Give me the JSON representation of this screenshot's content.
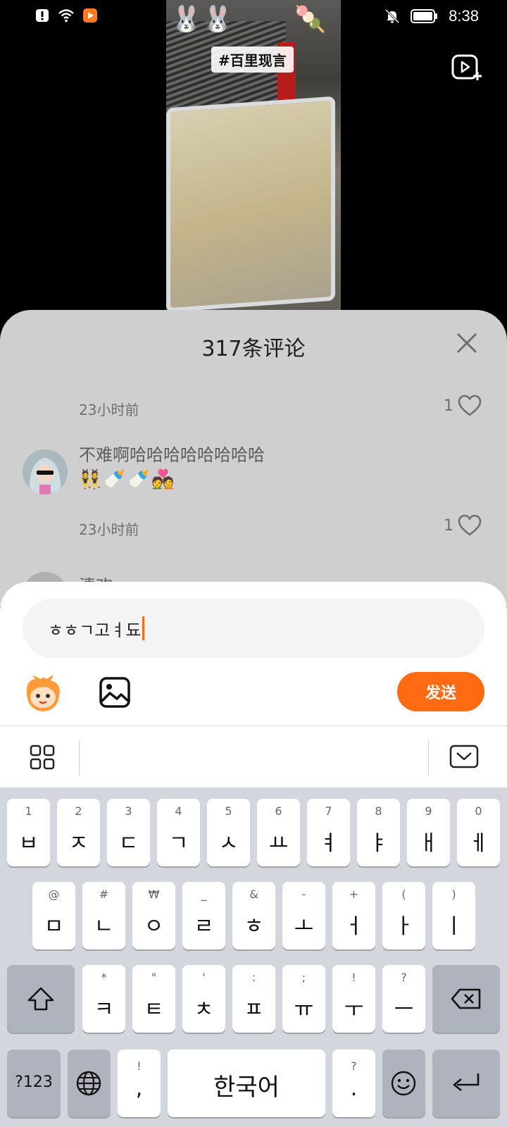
{
  "status_bar": {
    "time": "8:38",
    "icons": [
      "alert-icon",
      "wifi-icon",
      "app-notification-icon",
      "bell-muted-icon",
      "battery-icon"
    ]
  },
  "video": {
    "hashtag": "#百里现言"
  },
  "comments": {
    "title": "317条评论",
    "items": [
      {
        "time": "23小时前",
        "likes": "1"
      },
      {
        "text": "不难啊哈哈哈哈哈哈哈哈",
        "emojis": "👯🍼🍼💑",
        "time": "23小时前",
        "likes": "1"
      },
      {
        "author_partial": "清欢"
      }
    ]
  },
  "composer": {
    "input_value": "ㅎㅎㄱ고ㅕ됴",
    "send_label": "发送"
  },
  "keyboard": {
    "row1": [
      {
        "hint": "1",
        "main": "ㅂ"
      },
      {
        "hint": "2",
        "main": "ㅈ"
      },
      {
        "hint": "3",
        "main": "ㄷ"
      },
      {
        "hint": "4",
        "main": "ㄱ"
      },
      {
        "hint": "5",
        "main": "ㅅ"
      },
      {
        "hint": "6",
        "main": "ㅛ"
      },
      {
        "hint": "7",
        "main": "ㅕ"
      },
      {
        "hint": "8",
        "main": "ㅑ"
      },
      {
        "hint": "9",
        "main": "ㅐ"
      },
      {
        "hint": "0",
        "main": "ㅔ"
      }
    ],
    "row2": [
      {
        "hint": "@",
        "main": "ㅁ"
      },
      {
        "hint": "#",
        "main": "ㄴ"
      },
      {
        "hint": "₩",
        "main": "ㅇ"
      },
      {
        "hint": "_",
        "main": "ㄹ"
      },
      {
        "hint": "&",
        "main": "ㅎ"
      },
      {
        "hint": "-",
        "main": "ㅗ"
      },
      {
        "hint": "+",
        "main": "ㅓ"
      },
      {
        "hint": "(",
        "main": "ㅏ"
      },
      {
        "hint": ")",
        "main": "ㅣ"
      }
    ],
    "row3": [
      {
        "hint": "*",
        "main": "ㅋ"
      },
      {
        "hint": "\"",
        "main": "ㅌ"
      },
      {
        "hint": "'",
        "main": "ㅊ"
      },
      {
        "hint": ":",
        "main": "ㅍ"
      },
      {
        "hint": ";",
        "main": "ㅠ"
      },
      {
        "hint": "!",
        "main": "ㅜ"
      },
      {
        "hint": "?",
        "main": "ㅡ"
      }
    ],
    "sym_label": "?123",
    "comma": {
      "hint": "!",
      "main": ","
    },
    "space_label": "한국어",
    "period": {
      "hint": "?",
      "main": "."
    }
  }
}
